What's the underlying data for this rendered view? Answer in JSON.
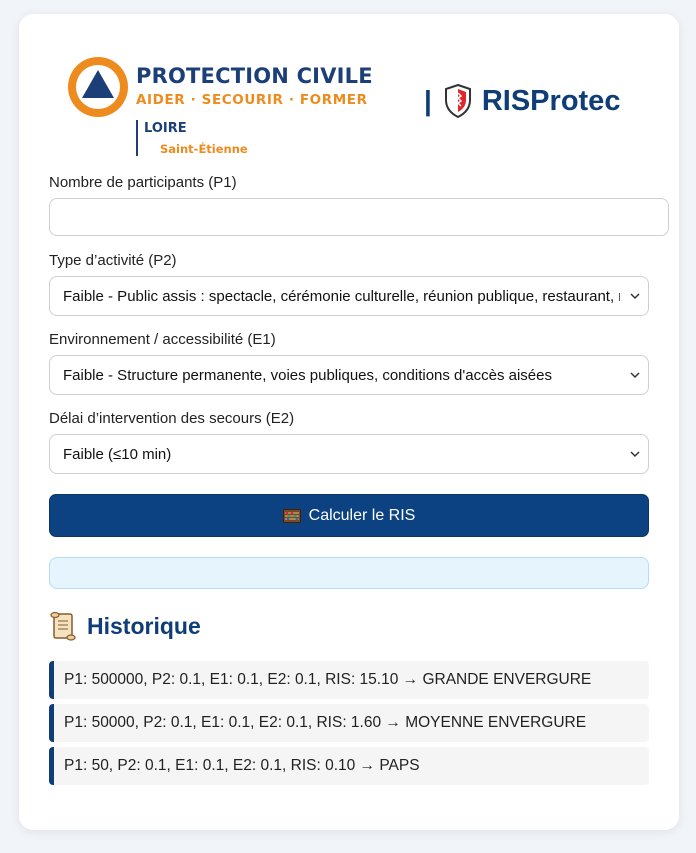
{
  "header": {
    "org_name": "PROTECTION CIVILE",
    "org_tagline": "AIDER · SECOURIR · FORMER",
    "org_region": "LOIRE",
    "org_city": "Saint-Étienne",
    "separator": "|",
    "app_name": "RISProtec",
    "colors": {
      "navy": "#1c3f78",
      "orange": "#ee8b1e",
      "accent": "#0f3d78"
    }
  },
  "form": {
    "p1": {
      "label": "Nombre de participants (P1)",
      "value": "",
      "placeholder": ""
    },
    "p2": {
      "label": "Type d’activité (P2)",
      "selected": "Faible - Public assis : spectacle, cérémonie culturelle, réunion publique, restaurant, rencontre sportive"
    },
    "e1": {
      "label": "Environnement / accessibilité (E1)",
      "selected": "Faible - Structure permanente, voies publiques, conditions d'accès aisées"
    },
    "e2": {
      "label": "Délai d’intervention des secours (E2)",
      "selected": "Faible (≤10 min)"
    },
    "submit_label": "Calculer le RIS",
    "submit_icon": "abacus-icon"
  },
  "result": {
    "text": ""
  },
  "history": {
    "title": "Historique",
    "icon": "scroll-icon",
    "items": [
      "P1: 500000, P2: 0.1, E1: 0.1, E2: 0.1, RIS: 15.10 → GRANDE ENVERGURE",
      "P1: 50000, P2: 0.1, E1: 0.1, E2: 0.1, RIS: 1.60 → MOYENNE ENVERGURE",
      "P1: 50, P2: 0.1, E1: 0.1, E2: 0.1, RIS: 0.10 → PAPS"
    ]
  }
}
